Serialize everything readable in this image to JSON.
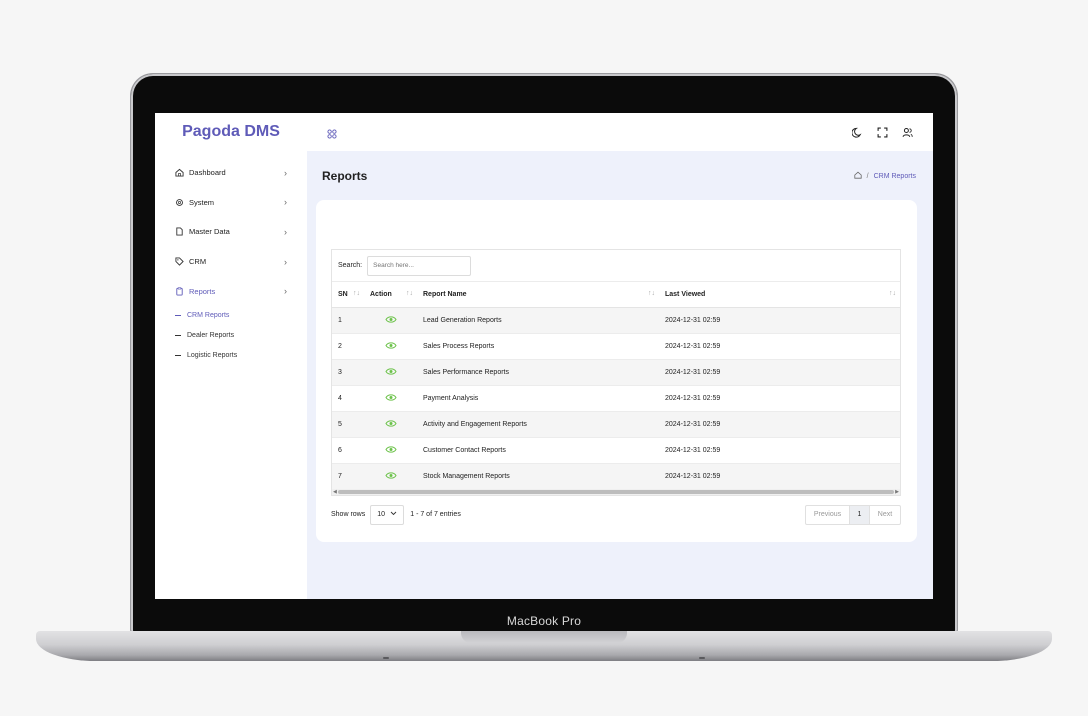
{
  "device": {
    "label": "MacBook Pro"
  },
  "app": {
    "brand": "Pagoda DMS"
  },
  "sidebar": {
    "items": [
      {
        "label": "Dashboard",
        "icon": "home-icon"
      },
      {
        "label": "System",
        "icon": "gear-icon"
      },
      {
        "label": "Master Data",
        "icon": "file-icon"
      },
      {
        "label": "CRM",
        "icon": "tag-icon"
      },
      {
        "label": "Reports",
        "icon": "clipboard-icon",
        "active": true
      }
    ],
    "subitems": [
      {
        "label": "CRM Reports",
        "active": true
      },
      {
        "label": "Dealer Reports"
      },
      {
        "label": "Logistic Reports"
      }
    ]
  },
  "topbar": {
    "icons": [
      "apps-icon",
      "moon-icon",
      "fullscreen-icon",
      "user-icon"
    ]
  },
  "page": {
    "title": "Reports",
    "breadcrumb": {
      "sep": "/",
      "current": "CRM Reports"
    }
  },
  "table": {
    "search_label": "Search:",
    "search_placeholder": "Search here...",
    "columns": [
      "SN",
      "Action",
      "Report Name",
      "Last Viewed"
    ],
    "rows": [
      {
        "sn": "1",
        "name": "Lead Generation Reports",
        "last": "2024-12-31 02:59"
      },
      {
        "sn": "2",
        "name": "Sales Process Reports",
        "last": "2024-12-31 02:59"
      },
      {
        "sn": "3",
        "name": "Sales Performance Reports",
        "last": "2024-12-31 02:59"
      },
      {
        "sn": "4",
        "name": "Payment Analysis",
        "last": "2024-12-31 02:59"
      },
      {
        "sn": "5",
        "name": "Activity and Engagement Reports",
        "last": "2024-12-31 02:59"
      },
      {
        "sn": "6",
        "name": "Customer Contact Reports",
        "last": "2024-12-31 02:59"
      },
      {
        "sn": "7",
        "name": "Stock Management Reports",
        "last": "2024-12-31 02:59"
      }
    ]
  },
  "footer": {
    "show_rows_label": "Show rows",
    "rows_value": "10",
    "entries_text": "1 - 7 of 7 entries",
    "prev_label": "Previous",
    "page": "1",
    "next_label": "Next"
  },
  "colors": {
    "accent": "#5f5bb8",
    "eye": "#6cc24a",
    "background": "#eef1fb"
  }
}
